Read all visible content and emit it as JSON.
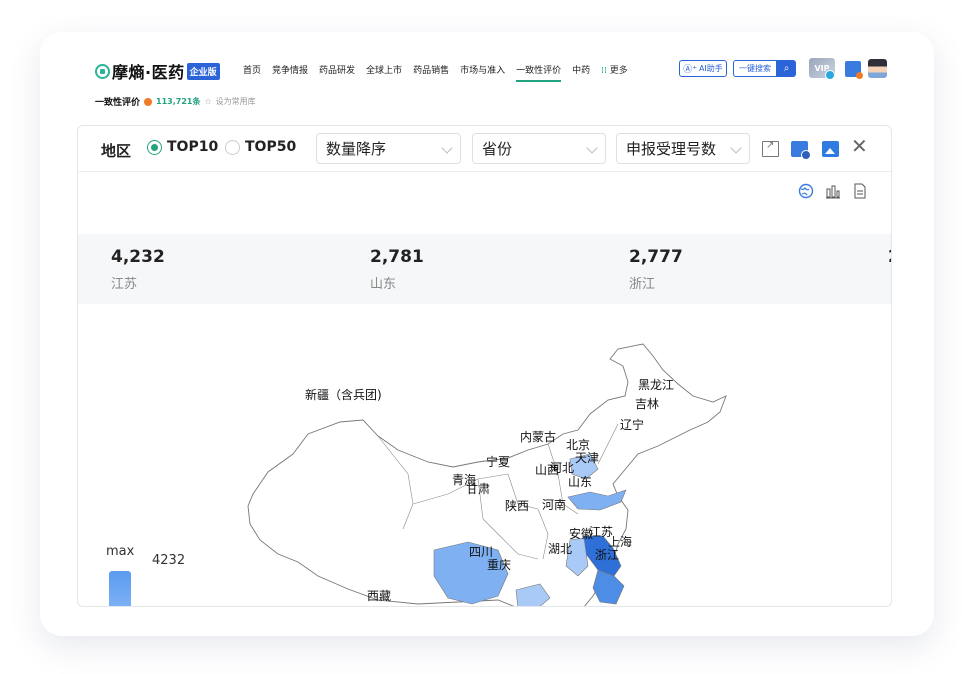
{
  "app": {
    "brand": "摩熵·医药",
    "badge": "企业版"
  },
  "nav": {
    "items": [
      "首页",
      "竞争情报",
      "药品研发",
      "全球上市",
      "药品销售",
      "市场与准入",
      "一致性评价",
      "中药",
      "更多"
    ],
    "active_index": 6
  },
  "header": {
    "ai_label": "AI助手",
    "search_label": "一键搜索",
    "vip_label": "VIP"
  },
  "subbar": {
    "title": "一致性评价",
    "count": "113,721条",
    "favorite": "设为常用库"
  },
  "controls": {
    "region_label": "地区",
    "radios": [
      {
        "label": "TOP10",
        "selected": true
      },
      {
        "label": "TOP50",
        "selected": false
      }
    ],
    "sort_select": "数量降序",
    "province_select": "省份",
    "metric_select": "申报受理号数"
  },
  "stats": [
    {
      "value": "4,232",
      "name": "江苏"
    },
    {
      "value": "2,781",
      "name": "山东"
    },
    {
      "value": "2,777",
      "name": "浙江"
    }
  ],
  "legend": {
    "max_label": "max",
    "max_value": "4232"
  },
  "map": {
    "labels": [
      "新疆（含兵团)",
      "西藏",
      "黑龙江",
      "吉林",
      "辽宁",
      "内蒙古",
      "北京",
      "天津",
      "河北",
      "宁夏",
      "山西",
      "山东",
      "青海",
      "甘肃",
      "陕西",
      "河南",
      "江苏",
      "安徽",
      "上海",
      "浙江",
      "湖北",
      "四川",
      "重庆"
    ],
    "highlight_colors": {
      "darkest": "#2f6fd8",
      "dark": "#4d8de6",
      "medium": "#7fb0f2",
      "light": "#a9c9f7"
    }
  }
}
